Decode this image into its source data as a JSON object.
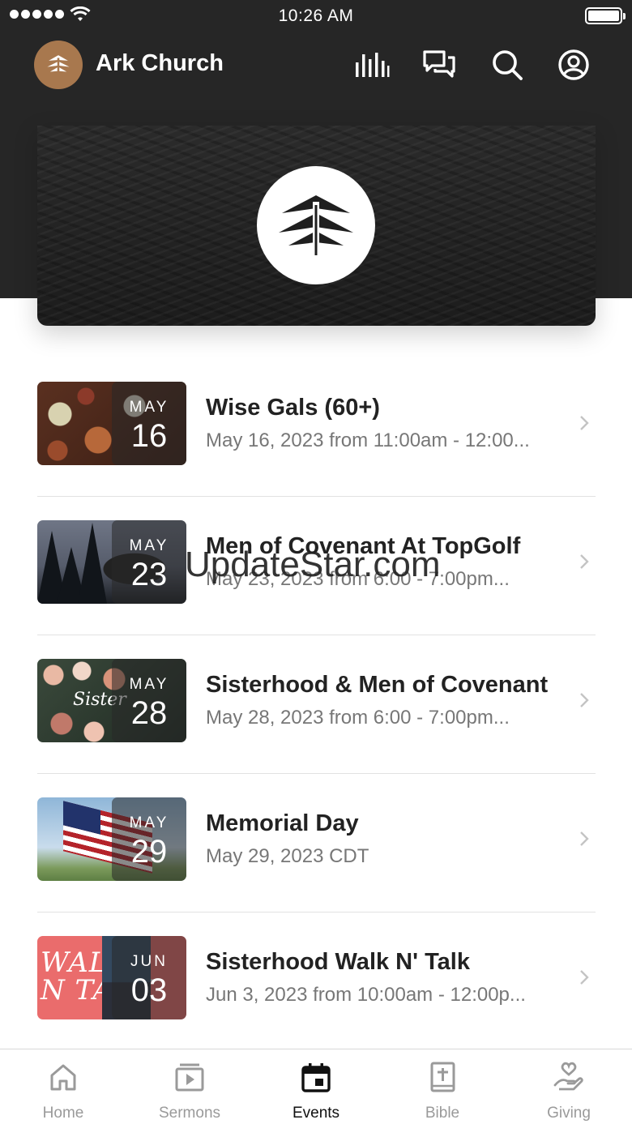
{
  "status_bar": {
    "time": "10:26 AM"
  },
  "header": {
    "title": "Ark Church"
  },
  "events": [
    {
      "title": "Wise Gals (60+)",
      "subtitle": "May 16, 2023 from 11:00am - 12:00...",
      "month": "MAY",
      "day": "16"
    },
    {
      "title": "Men of Covenant At TopGolf",
      "subtitle": "May 23, 2023 from 6:00 - 7:00pm...",
      "month": "MAY",
      "day": "23"
    },
    {
      "title": "Sisterhood & Men of Covenant",
      "subtitle": "May 28, 2023 from 6:00 - 7:00pm...",
      "month": "MAY",
      "day": "28"
    },
    {
      "title": "Memorial Day",
      "subtitle": "May 29, 2023 CDT",
      "month": "MAY",
      "day": "29"
    },
    {
      "title": "Sisterhood Walk N' Talk",
      "subtitle": "Jun 3, 2023 from 10:00am - 12:00p...",
      "month": "JUN",
      "day": "03"
    }
  ],
  "thumb_text": {
    "sister_script": "Sister",
    "walk_line1": "WALK",
    "walk_line2": "N TALK"
  },
  "watermark": "UpdateStar.com",
  "tabs": [
    {
      "label": "Home",
      "icon": "home-icon",
      "active": false
    },
    {
      "label": "Sermons",
      "icon": "video-icon",
      "active": false
    },
    {
      "label": "Events",
      "icon": "calendar-icon",
      "active": true
    },
    {
      "label": "Bible",
      "icon": "bible-icon",
      "active": false
    },
    {
      "label": "Giving",
      "icon": "giving-icon",
      "active": false
    }
  ],
  "colors": {
    "header_bg": "#262626",
    "logo_bg": "#a8784e",
    "active_tab": "#111111",
    "inactive_tab": "#9a9a9a"
  }
}
